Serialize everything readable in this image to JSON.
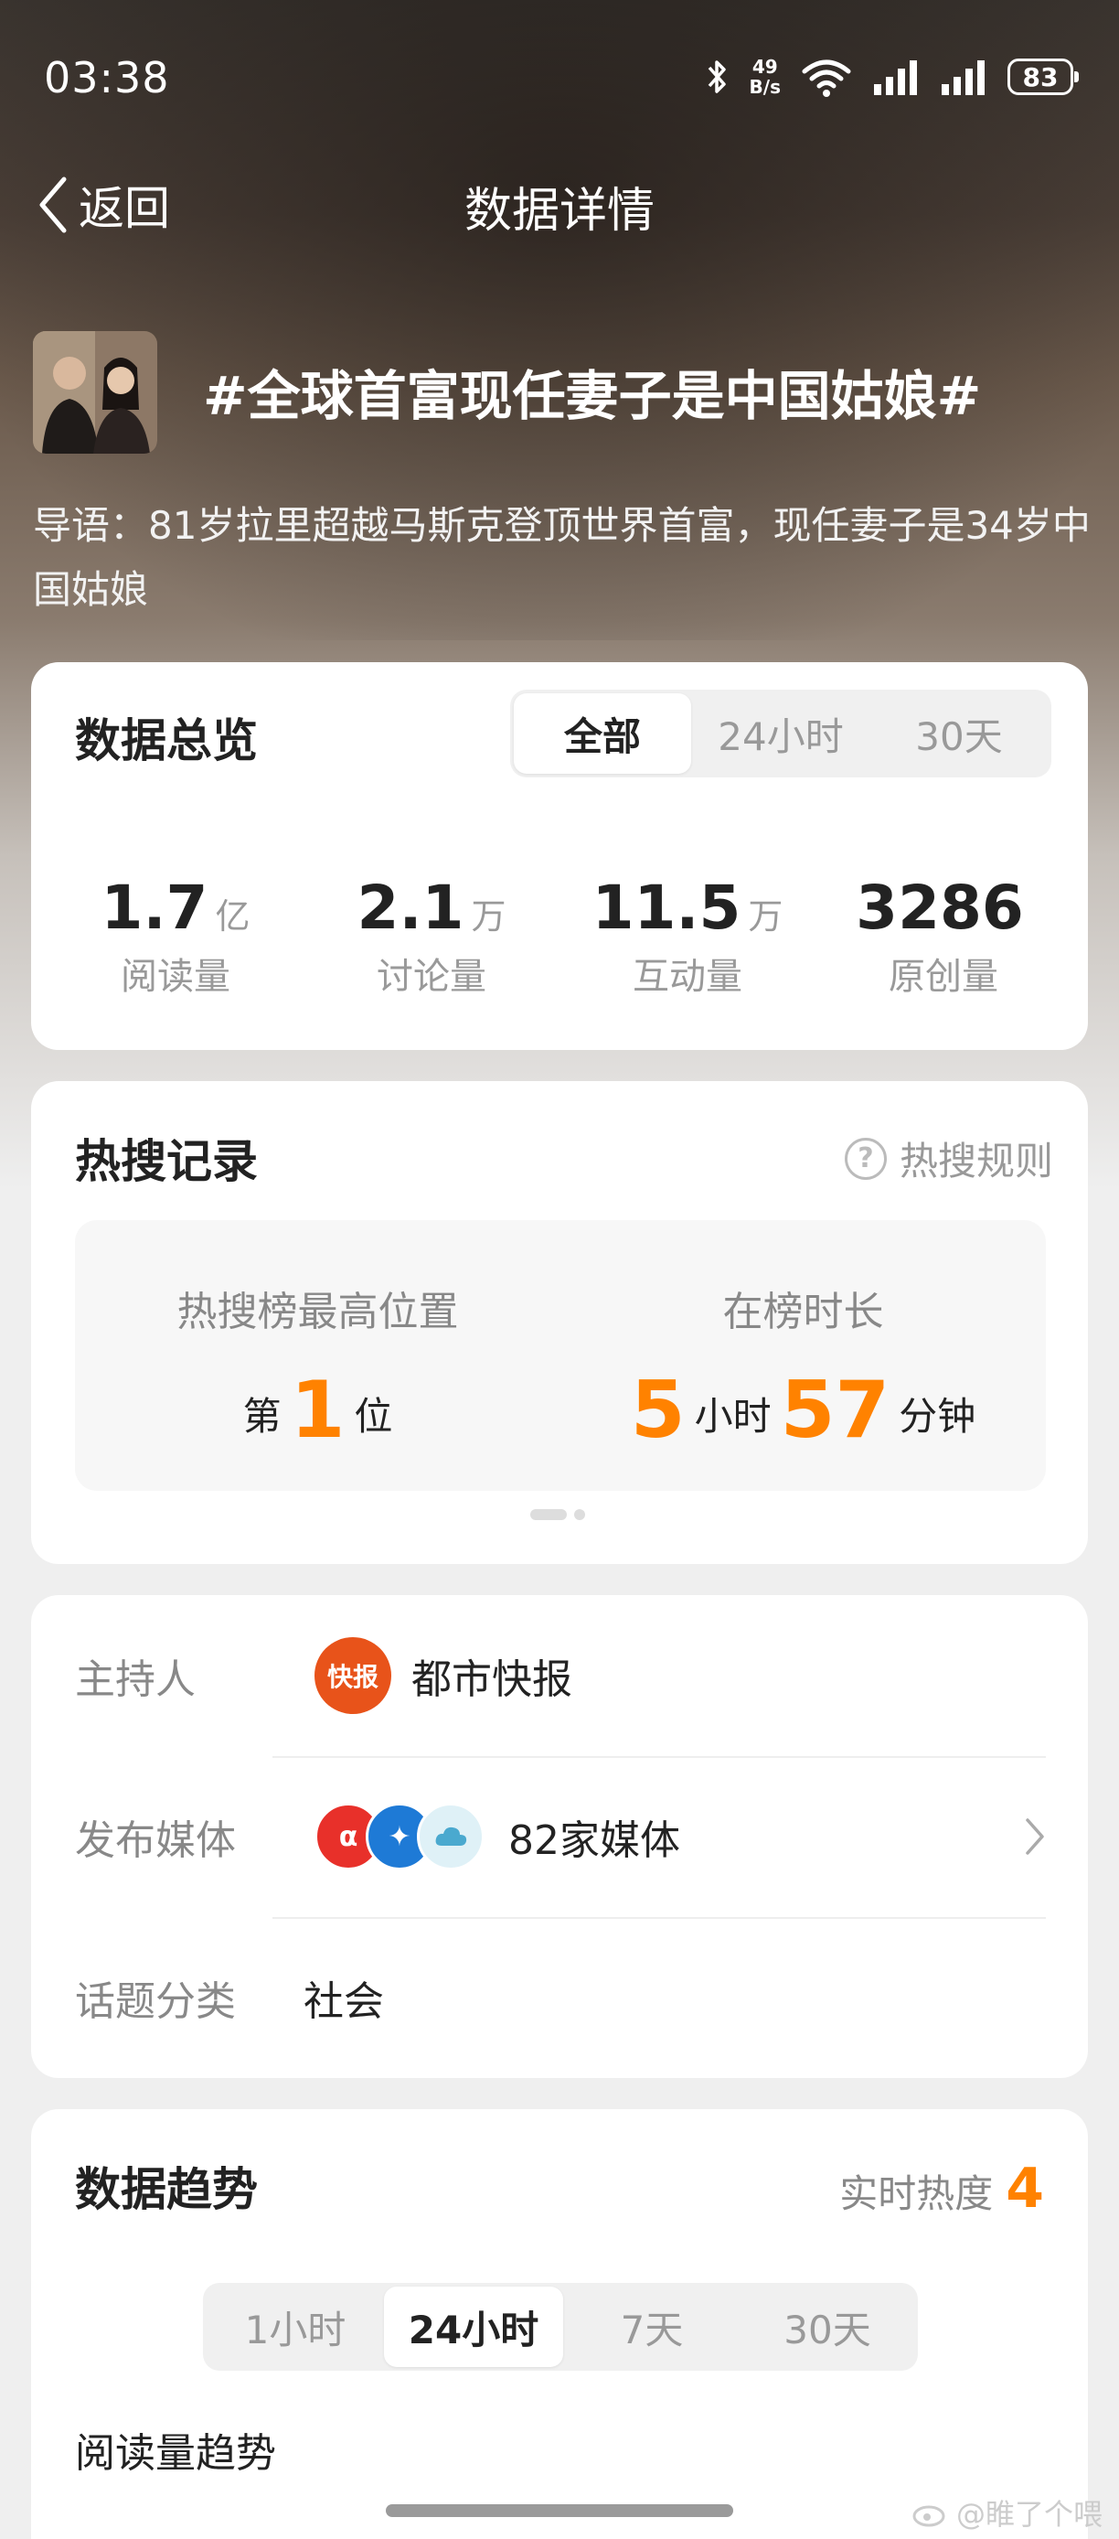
{
  "status_bar": {
    "time": "03:38",
    "net_speed_value": "49",
    "net_speed_unit": "B/s",
    "battery": "83"
  },
  "nav": {
    "back_label": "返回",
    "title": "数据详情"
  },
  "topic": {
    "title": "#全球首富现任妻子是中国姑娘#",
    "lead": "导语：81岁拉里超越马斯克登顶世界首富，现任妻子是34岁中国姑娘"
  },
  "overview": {
    "title": "数据总览",
    "tabs": [
      "全部",
      "24小时",
      "30天"
    ],
    "active_tab": "全部",
    "stats": [
      {
        "value": "1.7",
        "unit": "亿",
        "label": "阅读量"
      },
      {
        "value": "2.1",
        "unit": "万",
        "label": "讨论量"
      },
      {
        "value": "11.5",
        "unit": "万",
        "label": "互动量"
      },
      {
        "value": "3286",
        "unit": "",
        "label": "原创量"
      }
    ]
  },
  "hot_search": {
    "title": "热搜记录",
    "rule_label": "热搜规则",
    "rule_icon": "question-circle-icon",
    "highest_label": "热搜榜最高位置",
    "highest_prefix": "第",
    "highest_value": "1",
    "highest_suffix": "位",
    "duration_label": "在榜时长",
    "duration_hours": "5",
    "duration_hours_unit": "小时",
    "duration_minutes": "57",
    "duration_minutes_unit": "分钟"
  },
  "info": {
    "host_label": "主持人",
    "host_name": "都市快报",
    "host_logo_text": "快报",
    "media_label": "发布媒体",
    "media_value": "82家媒体",
    "category_label": "话题分类",
    "category_value": "社会"
  },
  "trend": {
    "title": "数据趋势",
    "heat_label": "实时热度",
    "heat_value": "4",
    "tabs": [
      "1小时",
      "24小时",
      "7天",
      "30天"
    ],
    "active_tab": "24小时",
    "subhead": "阅读量趋势"
  },
  "watermark": "@睢了个喂",
  "colors": {
    "accent_orange": "#ff8200",
    "host_logo": "#e8531a"
  }
}
